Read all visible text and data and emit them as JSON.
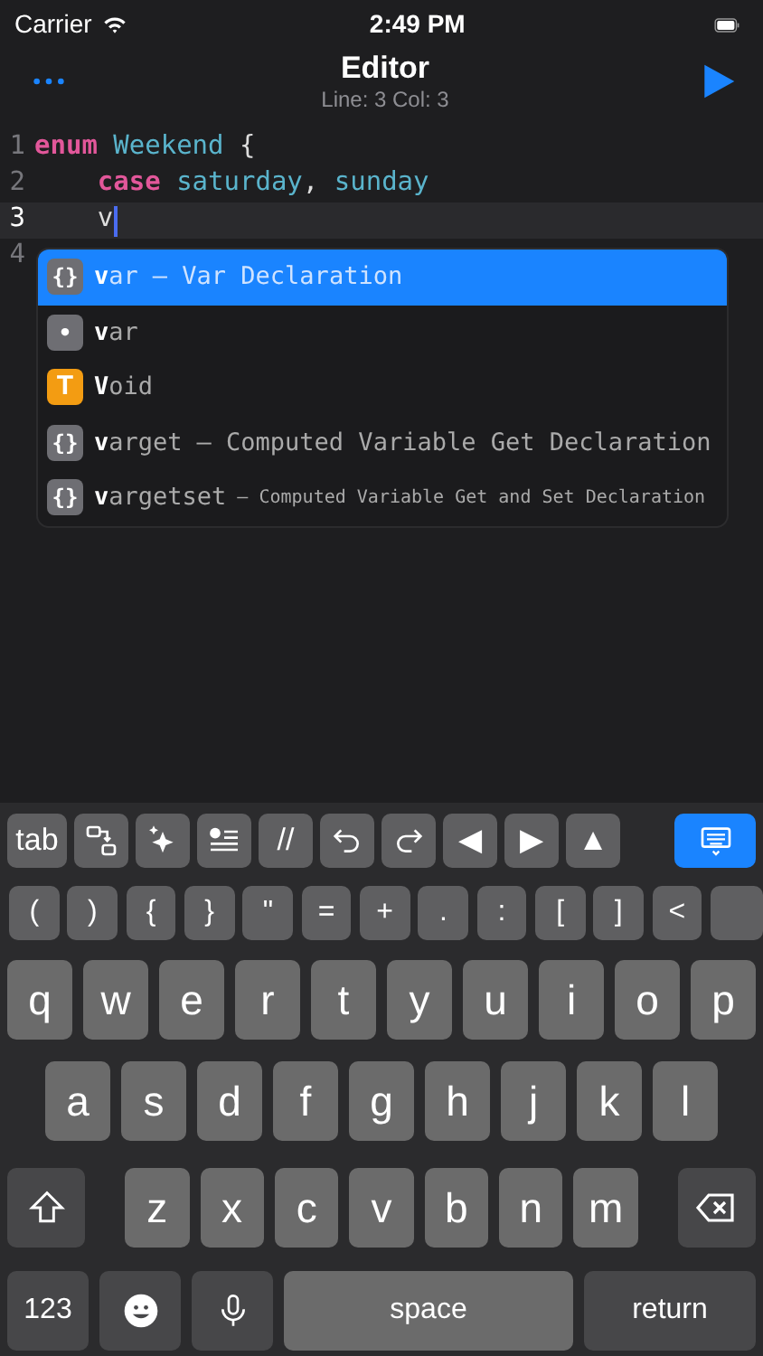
{
  "status_bar": {
    "carrier": "Carrier",
    "time": "2:49 PM"
  },
  "nav": {
    "title": "Editor",
    "subtitle": "Line: 3 Col: 3"
  },
  "code_lines": [
    {
      "number": "1",
      "current": false,
      "tokens": [
        {
          "text": "enum",
          "kind": "keyword"
        },
        {
          "text": " Weekend",
          "kind": "identifier"
        },
        {
          "text": " {",
          "kind": "plain"
        }
      ]
    },
    {
      "number": "2",
      "current": false,
      "tokens": [
        {
          "text": "    case",
          "kind": "keyword"
        },
        {
          "text": " saturday",
          "kind": "identifier"
        },
        {
          "text": ",",
          "kind": "plain"
        },
        {
          "text": " sunday",
          "kind": "identifier"
        }
      ]
    },
    {
      "number": "3",
      "current": true,
      "tokens": [
        {
          "text": "    v",
          "kind": "plain"
        }
      ]
    },
    {
      "number": "4",
      "current": false
    }
  ],
  "completions": [
    {
      "icon": "{}",
      "color": "#6e6e73",
      "label": "**v**ar",
      "detail": "– Var Declaration",
      "compact": false,
      "selected": true
    },
    {
      "icon": "•",
      "color": "#6e6e73",
      "label": "**v**ar",
      "selected": false
    },
    {
      "icon": "T",
      "color": "#f39c12",
      "label": "**V**oid",
      "selected": false
    },
    {
      "icon": "{}",
      "color": "#6e6e73",
      "label": "**v**arget",
      "detail": "– Computed Variable Get Declaration",
      "compact": false,
      "selected": false
    },
    {
      "icon": "{}",
      "color": "#6e6e73",
      "label": "**v**argetset",
      "detail": "– Computed Variable Get and Set Declaration",
      "compact": true,
      "selected": false
    }
  ],
  "toolbar": [
    {
      "kind": "text",
      "label": "tab"
    },
    {
      "kind": "swap"
    },
    {
      "kind": "sparkle"
    },
    {
      "kind": "checklist"
    },
    {
      "kind": "text",
      "label": "//"
    },
    {
      "kind": "undo"
    },
    {
      "kind": "redo"
    },
    {
      "kind": "text",
      "label": "◀"
    },
    {
      "kind": "text",
      "label": "▶"
    },
    {
      "kind": "text",
      "label": "▲"
    },
    {
      "kind": "hide_keyboard",
      "selected": true
    }
  ],
  "symbol_keys": [
    "(",
    ")",
    "{",
    "}",
    "\"",
    "=",
    "+",
    ".",
    ":",
    "[",
    "]",
    "<"
  ],
  "letter_rows": [
    [
      "q",
      "w",
      "e",
      "r",
      "t",
      "y",
      "u",
      "i",
      "o",
      "p"
    ],
    [
      "a",
      "s",
      "d",
      "f",
      "g",
      "h",
      "j",
      "k",
      "l"
    ],
    [
      "z",
      "x",
      "c",
      "v",
      "b",
      "n",
      "m"
    ]
  ],
  "bottom_row": {
    "numbers": "123",
    "space": "space",
    "return": "return"
  }
}
